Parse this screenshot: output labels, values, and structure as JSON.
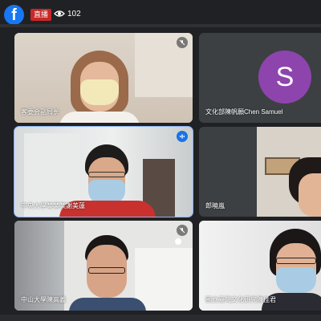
{
  "app": {
    "logo_letter": "f",
    "live_label": "直播",
    "viewer_count": "102"
  },
  "participants": [
    {
      "name": "客委会副局长"
    },
    {
      "name": "文化部陳帆願Chen Samuel",
      "avatar_letter": "S"
    },
    {
      "name": "中央大學某某某謝美蓮"
    },
    {
      "name": "郎曉嵐"
    },
    {
      "name": "中山大學陳高義"
    },
    {
      "name": "國立臺灣文化研究陳佳君"
    }
  ],
  "colors": {
    "accent": "#8ab4f8",
    "live_red": "#c62828",
    "facebook_blue": "#1877f2",
    "avatar_purple": "#8e44ad",
    "background": "#202124"
  },
  "icons": [
    "facebook-logo",
    "eye-icon",
    "mic-off-icon",
    "audio-wave-icon"
  ]
}
